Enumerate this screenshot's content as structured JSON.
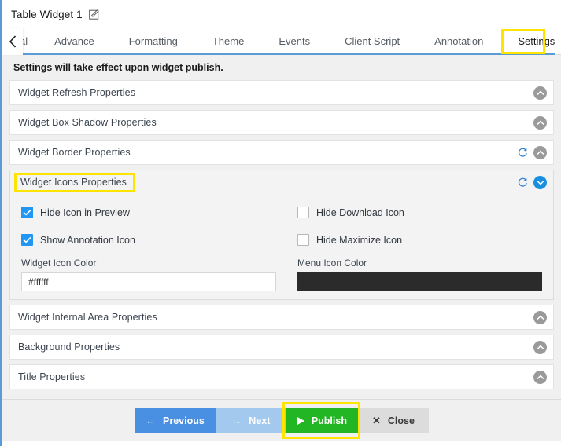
{
  "window": {
    "title": "Table Widget 1",
    "edit_icon": "pencil-edit-icon"
  },
  "tabs": {
    "scroll_left_icon": "chevron-left-icon",
    "items": [
      {
        "label": "al",
        "active": false,
        "partial": true
      },
      {
        "label": "Advance",
        "active": false
      },
      {
        "label": "Formatting",
        "active": false
      },
      {
        "label": "Theme",
        "active": false
      },
      {
        "label": "Events",
        "active": false
      },
      {
        "label": "Client Script",
        "active": false
      },
      {
        "label": "Annotation",
        "active": false
      },
      {
        "label": "Settings",
        "active": true
      }
    ]
  },
  "notice": "Settings will take effect upon widget publish.",
  "panels": [
    {
      "title": "Widget Refresh Properties",
      "expanded": false,
      "has_refresh": false
    },
    {
      "title": "Widget Box Shadow Properties",
      "expanded": false,
      "has_refresh": false
    },
    {
      "title": "Widget Border Properties",
      "expanded": false,
      "has_refresh": true
    },
    {
      "title": "Widget Icons Properties",
      "expanded": true,
      "has_refresh": true,
      "highlighted": true
    },
    {
      "title": "Widget Internal Area Properties",
      "expanded": false,
      "has_refresh": false
    },
    {
      "title": "Background Properties",
      "expanded": false,
      "has_refresh": false
    },
    {
      "title": "Title Properties",
      "expanded": false,
      "has_refresh": false
    }
  ],
  "widget_icons_properties": {
    "checkboxes": [
      {
        "label": "Hide Icon in Preview",
        "checked": true
      },
      {
        "label": "Hide Download Icon",
        "checked": false
      },
      {
        "label": "Show Annotation Icon",
        "checked": true
      },
      {
        "label": "Hide Maximize Icon",
        "checked": false
      }
    ],
    "widget_icon_color": {
      "label": "Widget Icon Color",
      "value": "#ffffff"
    },
    "menu_icon_color": {
      "label": "Menu Icon Color",
      "value": "#2b2b2b"
    }
  },
  "footer": {
    "previous": "Previous",
    "next": "Next",
    "publish": "Publish",
    "close": "Close"
  },
  "colors": {
    "accent_blue": "#5b9bd5",
    "checkbox_blue": "#2196f3",
    "publish_green": "#22b524",
    "previous_blue": "#4a90e2",
    "next_blue": "#a4c9ef",
    "highlight_yellow": "#ffe400",
    "swatch_dark": "#2b2b2b"
  }
}
